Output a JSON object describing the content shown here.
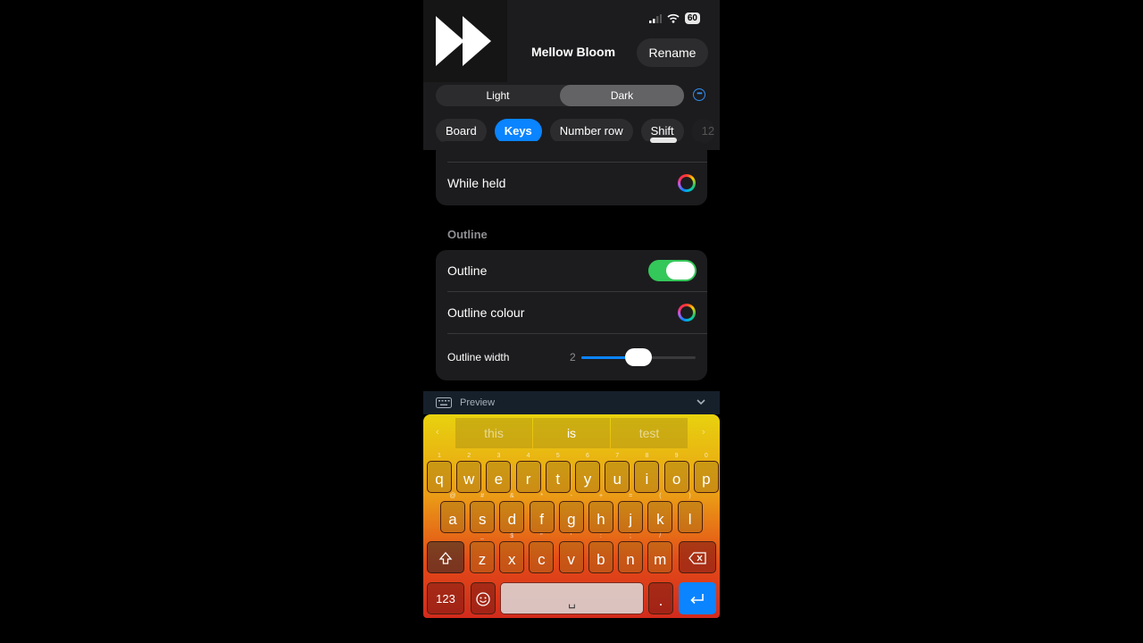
{
  "header": {
    "theme_name": "Mellow Bloom",
    "rename_label": "Rename",
    "battery": "60"
  },
  "appearance": {
    "segments": [
      "Light",
      "Dark"
    ],
    "selected": "Dark"
  },
  "chips": [
    "Board",
    "Keys",
    "Number row",
    "Shift",
    "12"
  ],
  "active_chip": "Keys",
  "settings": {
    "while_held_label": "While held",
    "outline_section": "Outline",
    "outline_label": "Outline",
    "outline_enabled": true,
    "outline_colour_label": "Outline colour",
    "outline_width_label": "Outline width",
    "outline_width_value": "2",
    "outline_width_fraction": 0.5
  },
  "preview": {
    "label": "Preview"
  },
  "keyboard": {
    "suggestions": [
      "this",
      "is",
      "test"
    ],
    "row1": [
      {
        "k": "q",
        "h": "1"
      },
      {
        "k": "w",
        "h": "2"
      },
      {
        "k": "e",
        "h": "3"
      },
      {
        "k": "r",
        "h": "4"
      },
      {
        "k": "t",
        "h": "5"
      },
      {
        "k": "y",
        "h": "6"
      },
      {
        "k": "u",
        "h": "7"
      },
      {
        "k": "i",
        "h": "8"
      },
      {
        "k": "o",
        "h": "9"
      },
      {
        "k": "p",
        "h": "0"
      }
    ],
    "row2": [
      {
        "k": "a",
        "h": "@"
      },
      {
        "k": "s",
        "h": "#"
      },
      {
        "k": "d",
        "h": "&"
      },
      {
        "k": "f",
        "h": "*"
      },
      {
        "k": "g",
        "h": "-"
      },
      {
        "k": "h",
        "h": "+"
      },
      {
        "k": "j",
        "h": "="
      },
      {
        "k": "k",
        "h": "("
      },
      {
        "k": "l",
        "h": ")"
      }
    ],
    "row3": [
      {
        "k": "z",
        "h": "_"
      },
      {
        "k": "x",
        "h": "$"
      },
      {
        "k": "c",
        "h": "\""
      },
      {
        "k": "v",
        "h": "'"
      },
      {
        "k": "b",
        "h": ":"
      },
      {
        "k": "n",
        "h": ";"
      },
      {
        "k": "m",
        "h": "/"
      }
    ],
    "num_label": "123",
    "space_label": "␣",
    "period_label": "."
  }
}
